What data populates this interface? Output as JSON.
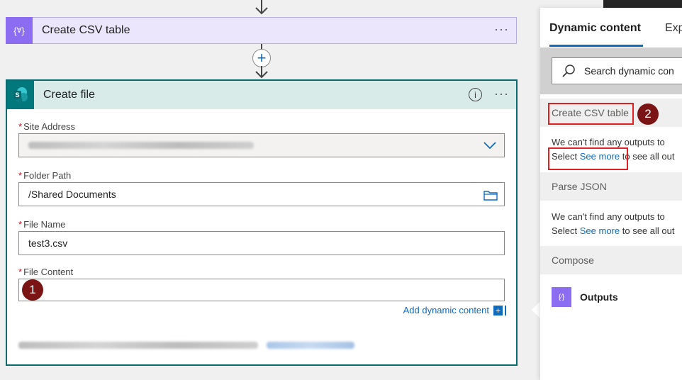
{
  "flow": {
    "csv_action": {
      "title": "Create CSV table",
      "icon": "braces-icon"
    },
    "file_action": {
      "title": "Create file",
      "icon": "sharepoint-icon",
      "fields": {
        "site_address": {
          "label": "Site Address",
          "value": ""
        },
        "folder_path": {
          "label": "Folder Path",
          "value": "/Shared Documents"
        },
        "file_name": {
          "label": "File Name",
          "value": "test3.csv"
        },
        "file_content": {
          "label": "File Content",
          "value": ""
        }
      },
      "add_dynamic_label": "Add dynamic content",
      "required_mark": "*",
      "step_badge": "1"
    },
    "more_glyph": "···",
    "plus_glyph": "+",
    "info_glyph": "i"
  },
  "panel": {
    "tabs": [
      "Dynamic content",
      "Exp"
    ],
    "search_placeholder": "Search dynamic con",
    "sections": [
      {
        "title": "Create CSV table",
        "msg_line1": "We can't find any outputs to",
        "msg_pre": "Select ",
        "msg_link": "See more",
        "msg_post": " to see all out"
      },
      {
        "title": "Parse JSON",
        "msg_line1": "We can't find any outputs to",
        "msg_pre": "Select ",
        "msg_link": "See more",
        "msg_post": " to see all out"
      },
      {
        "title": "Compose"
      }
    ],
    "output_item": "Outputs",
    "step_badge": "2"
  },
  "colors": {
    "accent": "#0f6cbd",
    "csv_purple": "#8c6cf0",
    "sharepoint_teal": "#03787c",
    "badge": "#7b1414",
    "highlight": "#e02020"
  }
}
